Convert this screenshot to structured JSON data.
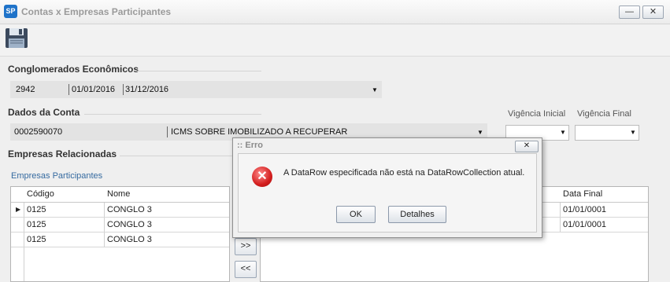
{
  "window": {
    "title": "Contas x Empresas Participantes",
    "icon_text": "SP",
    "minimize": "—",
    "close": "✕"
  },
  "toolbar": {
    "save_icon": "floppy-disk-icon"
  },
  "conglomerados": {
    "title": "Conglomerados Econômicos",
    "code": "2942",
    "start": "01/01/2016",
    "end": "31/12/2016"
  },
  "conta": {
    "title": "Dados da Conta",
    "number": "0002590070",
    "description": "ICMS SOBRE IMOBILIZADO A RECUPERAR",
    "vigencia_inicial_label": "Vigência Inicial",
    "vigencia_final_label": "Vigência Final"
  },
  "empresas": {
    "title": "Empresas Relacionadas",
    "participantes_label": "Empresas Participantes",
    "left_grid": {
      "columns": [
        "Código",
        "Nome"
      ],
      "rows": [
        {
          "codigo": "0125",
          "nome": "CONGLO 3"
        },
        {
          "codigo": "0125",
          "nome": "CONGLO 3"
        },
        {
          "codigo": "0125",
          "nome": "CONGLO 3"
        }
      ]
    },
    "right_grid": {
      "columns": [
        "Data Final"
      ],
      "rows": [
        {
          "data_final": "01/01/0001"
        },
        {
          "data_final": "01/01/0001"
        }
      ]
    },
    "move_right": ">>",
    "move_left": "<<"
  },
  "dialog": {
    "title": ":: Erro",
    "close": "✕",
    "message": "A DataRow especificada não está na DataRowCollection atual.",
    "ok": "OK",
    "details": "Detalhes"
  }
}
